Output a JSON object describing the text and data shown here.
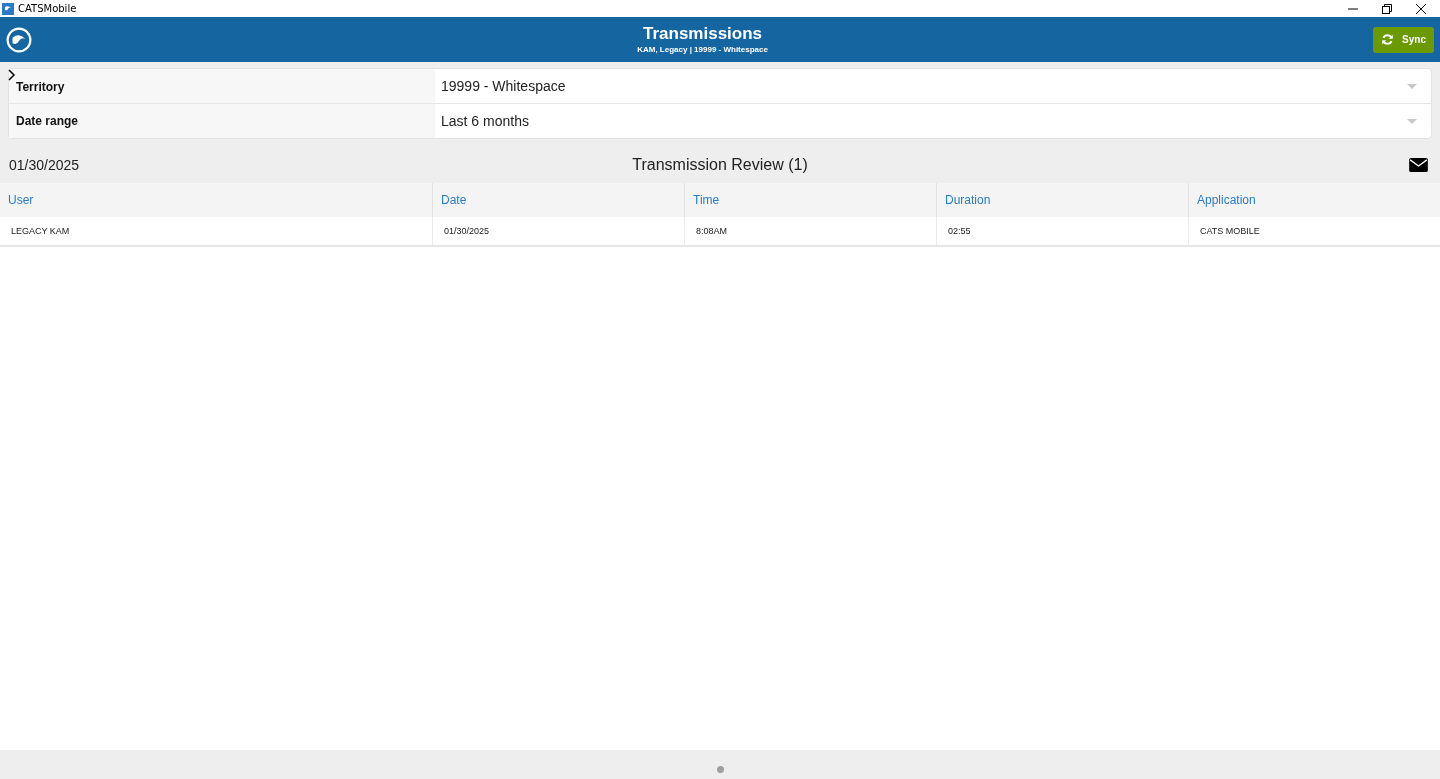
{
  "window": {
    "title": "CATSMobile"
  },
  "header": {
    "title": "Transmissions",
    "subtitle": "KAM, Legacy | 19999 - Whitespace",
    "sync_label": "Sync"
  },
  "filters": [
    {
      "label": "Territory",
      "value": "19999 - Whitespace"
    },
    {
      "label": "Date range",
      "value": "Last 6 months"
    }
  ],
  "review": {
    "date": "01/30/2025",
    "title": "Transmission Review (1)"
  },
  "table": {
    "columns": [
      "User",
      "Date",
      "Time",
      "Duration",
      "Application"
    ],
    "rows": [
      [
        "LEGACY KAM",
        "01/30/2025",
        "8:08AM",
        "02:55",
        "CATS MOBILE"
      ]
    ]
  }
}
